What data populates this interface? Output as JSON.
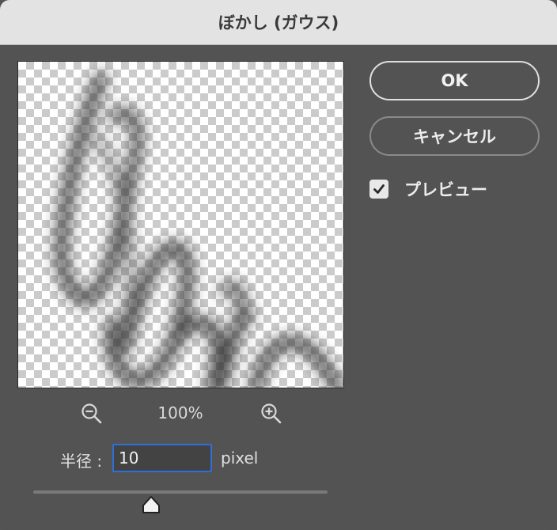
{
  "dialog": {
    "title": "ぼかし (ガウス)"
  },
  "zoom": {
    "level": "100%"
  },
  "radius": {
    "label": "半径 :",
    "value": "10",
    "unit": "pixel",
    "slider_fraction": 0.4
  },
  "buttons": {
    "ok_label": "OK",
    "cancel_label": "キャンセル"
  },
  "preview_option": {
    "label": "プレビュー",
    "checked": true
  },
  "colors": {
    "accent": "#2f6fd6",
    "dialog_bg": "#535353",
    "titlebar": "#e3e3e3"
  }
}
